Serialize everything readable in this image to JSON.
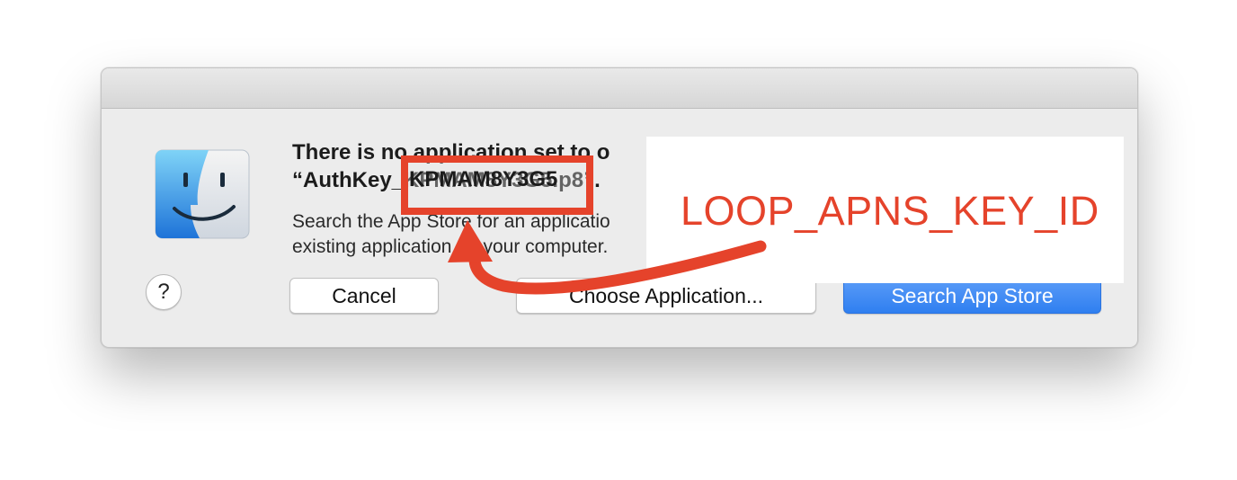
{
  "dialog": {
    "title": "There is no application set to o\n“AuthKey_KPMAM8Y3G5.p8”.",
    "body": "Search the App Store for an applicatio\nexisting application on your computer.",
    "help_label": "?",
    "buttons": {
      "cancel": "Cancel",
      "choose": "Choose Application...",
      "search": "Search App Store"
    }
  },
  "annotation": {
    "highlighted_text": "KPMAM8Y3G5",
    "label": "LOOP_APNS_KEY_ID",
    "color": "#e5432b"
  },
  "icons": {
    "app_icon": "finder-icon",
    "help": "help-icon",
    "arrow": "annotation-arrow"
  },
  "colors": {
    "primary_button": "#2f7ff0",
    "dialog_bg": "#ececec"
  }
}
